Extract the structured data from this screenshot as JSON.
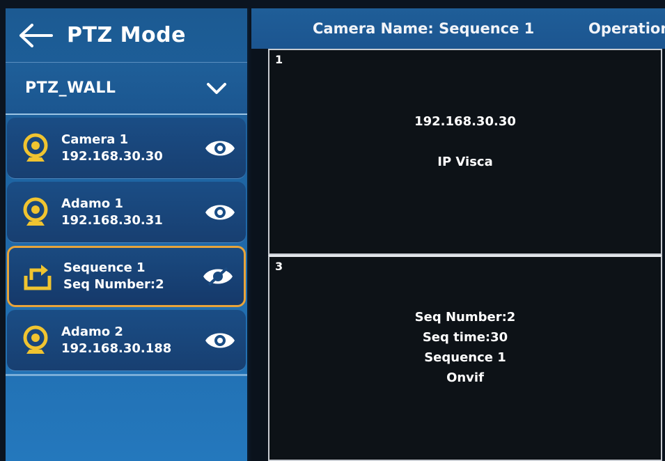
{
  "sidebar": {
    "title": "PTZ Mode",
    "group": "PTZ_WALL",
    "cameras": [
      {
        "name": "Camera 1",
        "sub": "192.168.30.30",
        "icon": "webcam-icon",
        "visible": true
      },
      {
        "name": "Adamo 1",
        "sub": "192.168.30.31",
        "icon": "webcam-icon",
        "visible": true
      },
      {
        "name": "Sequence 1",
        "sub": "Seq Number:2",
        "icon": "sequence-icon",
        "visible": false,
        "selected": true
      },
      {
        "name": "Adamo 2",
        "sub": "192.168.30.188",
        "icon": "webcam-icon",
        "visible": true
      }
    ]
  },
  "header": {
    "camera_name": "Camera Name: Sequence 1",
    "operation": "Operation"
  },
  "tiles": [
    {
      "number": "1",
      "lines": [
        "192.168.30.30",
        "IP Visca"
      ]
    },
    {
      "number": "3",
      "lines": [
        "Seq Number:2",
        "Seq time:30",
        "Sequence 1",
        "Onvif"
      ]
    }
  ],
  "colors": {
    "accent_icon": "#f0c430",
    "selected_border": "#e8a43a",
    "sidebar_blue": "#1f67a6"
  }
}
